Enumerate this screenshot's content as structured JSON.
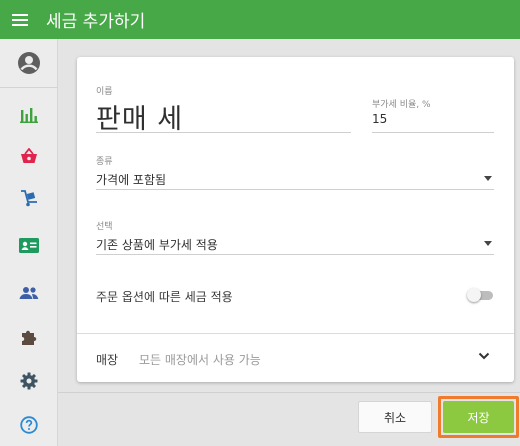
{
  "appbar": {
    "title": "세금 추가하기",
    "menu_icon": "hamburger-menu-icon"
  },
  "sidebar": {
    "items": [
      {
        "name": "account",
        "icon": "account-circle-icon"
      },
      {
        "name": "reports",
        "icon": "bar-chart-icon"
      },
      {
        "name": "sales",
        "icon": "basket-icon"
      },
      {
        "name": "items",
        "icon": "dolly-icon"
      },
      {
        "name": "employees",
        "icon": "id-card-icon"
      },
      {
        "name": "customers",
        "icon": "people-icon"
      },
      {
        "name": "integrations",
        "icon": "puzzle-icon"
      },
      {
        "name": "settings",
        "icon": "gear-icon"
      },
      {
        "name": "help",
        "icon": "help-circle-icon"
      }
    ],
    "icon_color": "#3ea33e",
    "active_colors": {
      "sales": "#e0244d",
      "employees": "#1f9a5f",
      "customers": "#3c5fa8",
      "integrations": "#5b4a3f",
      "settings": "#3f5463",
      "help": "#2a8ad4"
    }
  },
  "form": {
    "name": {
      "label": "이름",
      "value": "판매 세"
    },
    "rate": {
      "label": "부가세 비율, %",
      "value": "15"
    },
    "type": {
      "label": "종류",
      "value": "가격에 포함됨"
    },
    "option": {
      "label": "선택",
      "value": "기존 상품에 부가세 적용"
    },
    "order_toggle": {
      "label": "주문 옵션에 따른 세금 적용",
      "on": false
    },
    "stores": {
      "label": "매장",
      "value": "모든 매장에서 사용 가능"
    }
  },
  "buttons": {
    "cancel": "취소",
    "save": "저장"
  },
  "colors": {
    "appbar": "#47a847",
    "save": "#8cc840",
    "save_highlight": "#f07b2c"
  }
}
